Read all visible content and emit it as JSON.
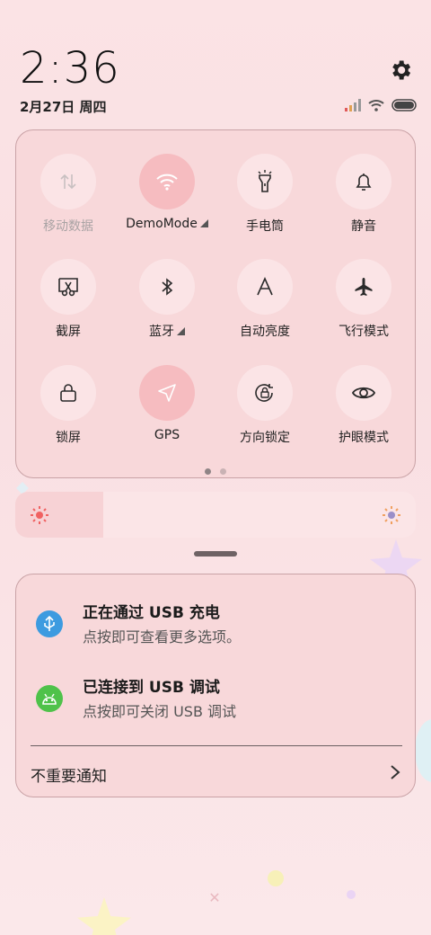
{
  "header": {
    "time": "2:36",
    "date": "2月27日 周四"
  },
  "tiles": [
    {
      "label": "移动数据",
      "icon": "mobile-data-icon",
      "state": "disabled",
      "caret": false
    },
    {
      "label": "DemoMode",
      "icon": "wifi-icon",
      "state": "active",
      "caret": true
    },
    {
      "label": "手电筒",
      "icon": "flashlight-icon",
      "state": "off",
      "caret": false
    },
    {
      "label": "静音",
      "icon": "bell-icon",
      "state": "off",
      "caret": false
    },
    {
      "label": "截屏",
      "icon": "screenshot-icon",
      "state": "off",
      "caret": false
    },
    {
      "label": "蓝牙",
      "icon": "bluetooth-icon",
      "state": "off",
      "caret": true
    },
    {
      "label": "自动亮度",
      "icon": "auto-brightness-icon",
      "state": "off",
      "caret": false
    },
    {
      "label": "飞行模式",
      "icon": "airplane-icon",
      "state": "off",
      "caret": false
    },
    {
      "label": "锁屏",
      "icon": "lock-icon",
      "state": "off",
      "caret": false
    },
    {
      "label": "GPS",
      "icon": "location-icon",
      "state": "active",
      "caret": false
    },
    {
      "label": "方向锁定",
      "icon": "rotation-lock-icon",
      "state": "off",
      "caret": false
    },
    {
      "label": "护眼模式",
      "icon": "eye-icon",
      "state": "off",
      "caret": false
    }
  ],
  "brightness_level": 0.22,
  "notifications": [
    {
      "title": "正在通过 USB 充电",
      "subtitle": "点按即可查看更多选项。",
      "icon": "usb-icon",
      "color": "#3d9be0"
    },
    {
      "title": "已连接到 USB 调试",
      "subtitle": "点按即可关闭 USB 调试",
      "icon": "android-debug-icon",
      "color": "#4fc24a"
    }
  ],
  "unimportant_label": "不重要通知",
  "colors": {
    "background": "#fbe3e5",
    "panel": "#f8d8da",
    "active_tile": "#f6bcc0"
  }
}
